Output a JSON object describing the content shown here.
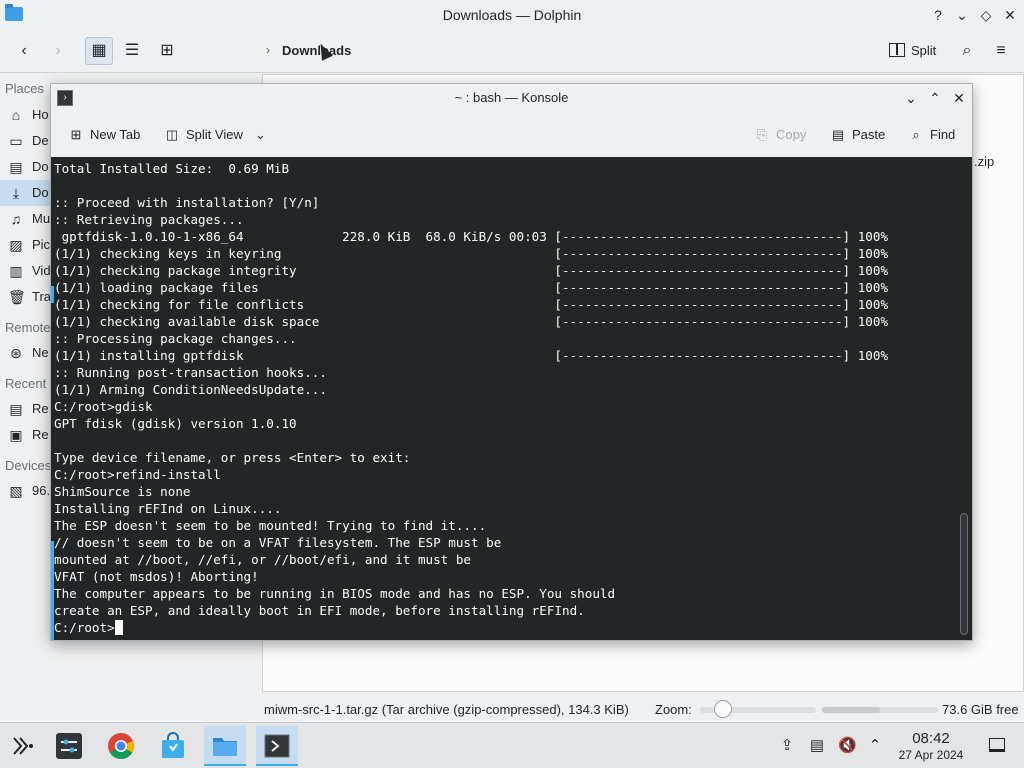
{
  "dolphin": {
    "window_title": "Downloads — Dolphin",
    "breadcrumb": "Downloads",
    "split_label": "Split",
    "places": {
      "sections": {
        "places": "Places",
        "remote": "Remote",
        "recent": "Recent",
        "devices": "Devices"
      },
      "items": [
        "Ho",
        "De",
        "Do",
        "Do",
        "Mu",
        "Pic",
        "Vid",
        "Tra",
        "Ne",
        "Re",
        "Re",
        "96."
      ]
    },
    "visible_file_fragment": ".zip",
    "status": {
      "selection_text": "miwm-src-1-1.tar.gz (Tar archive (gzip-compressed), 134.3 KiB)",
      "zoom_label": "Zoom:",
      "zoom_level": 0.2,
      "free_space": "73.6 GiB free"
    }
  },
  "konsole": {
    "window_title": "~ : bash — Konsole",
    "toolbar": {
      "new_tab": "New Tab",
      "split_view": "Split View",
      "copy": "Copy",
      "paste": "Paste",
      "find": "Find"
    },
    "terminal_lines": [
      "Total Installed Size:  0.69 MiB",
      "",
      ":: Proceed with installation? [Y/n]",
      ":: Retrieving packages...",
      " gptfdisk-1.0.10-1-x86_64             228.0 KiB  68.0 KiB/s 00:03 [-------------------------------------] 100%",
      "(1/1) checking keys in keyring                                    [-------------------------------------] 100%",
      "(1/1) checking package integrity                                  [-------------------------------------] 100%",
      "(1/1) loading package files                                       [-------------------------------------] 100%",
      "(1/1) checking for file conflicts                                 [-------------------------------------] 100%",
      "(1/1) checking available disk space                               [-------------------------------------] 100%",
      ":: Processing package changes...",
      "(1/1) installing gptfdisk                                         [-------------------------------------] 100%",
      ":: Running post-transaction hooks...",
      "(1/1) Arming ConditionNeedsUpdate...",
      "C:/root>gdisk",
      "GPT fdisk (gdisk) version 1.0.10",
      "",
      "Type device filename, or press <Enter> to exit:",
      "C:/root>refind-install",
      "ShimSource is none",
      "Installing rEFInd on Linux....",
      "The ESP doesn't seem to be mounted! Trying to find it....",
      "// doesn't seem to be on a VFAT filesystem. The ESP must be",
      "mounted at //boot, //efi, or //boot/efi, and it must be",
      "VFAT (not msdos)! Aborting!",
      "The computer appears to be running in BIOS mode and has no ESP. You should",
      "create an ESP, and ideally boot in EFI mode, before installing rEFInd."
    ],
    "prompt": "C:/root>"
  },
  "taskbar": {
    "time": "08:42",
    "date": "27 Apr 2024"
  },
  "colors": {
    "accent": "#3daee9",
    "terminal_bg": "#232627",
    "terminal_fg": "#fcfcfc"
  }
}
